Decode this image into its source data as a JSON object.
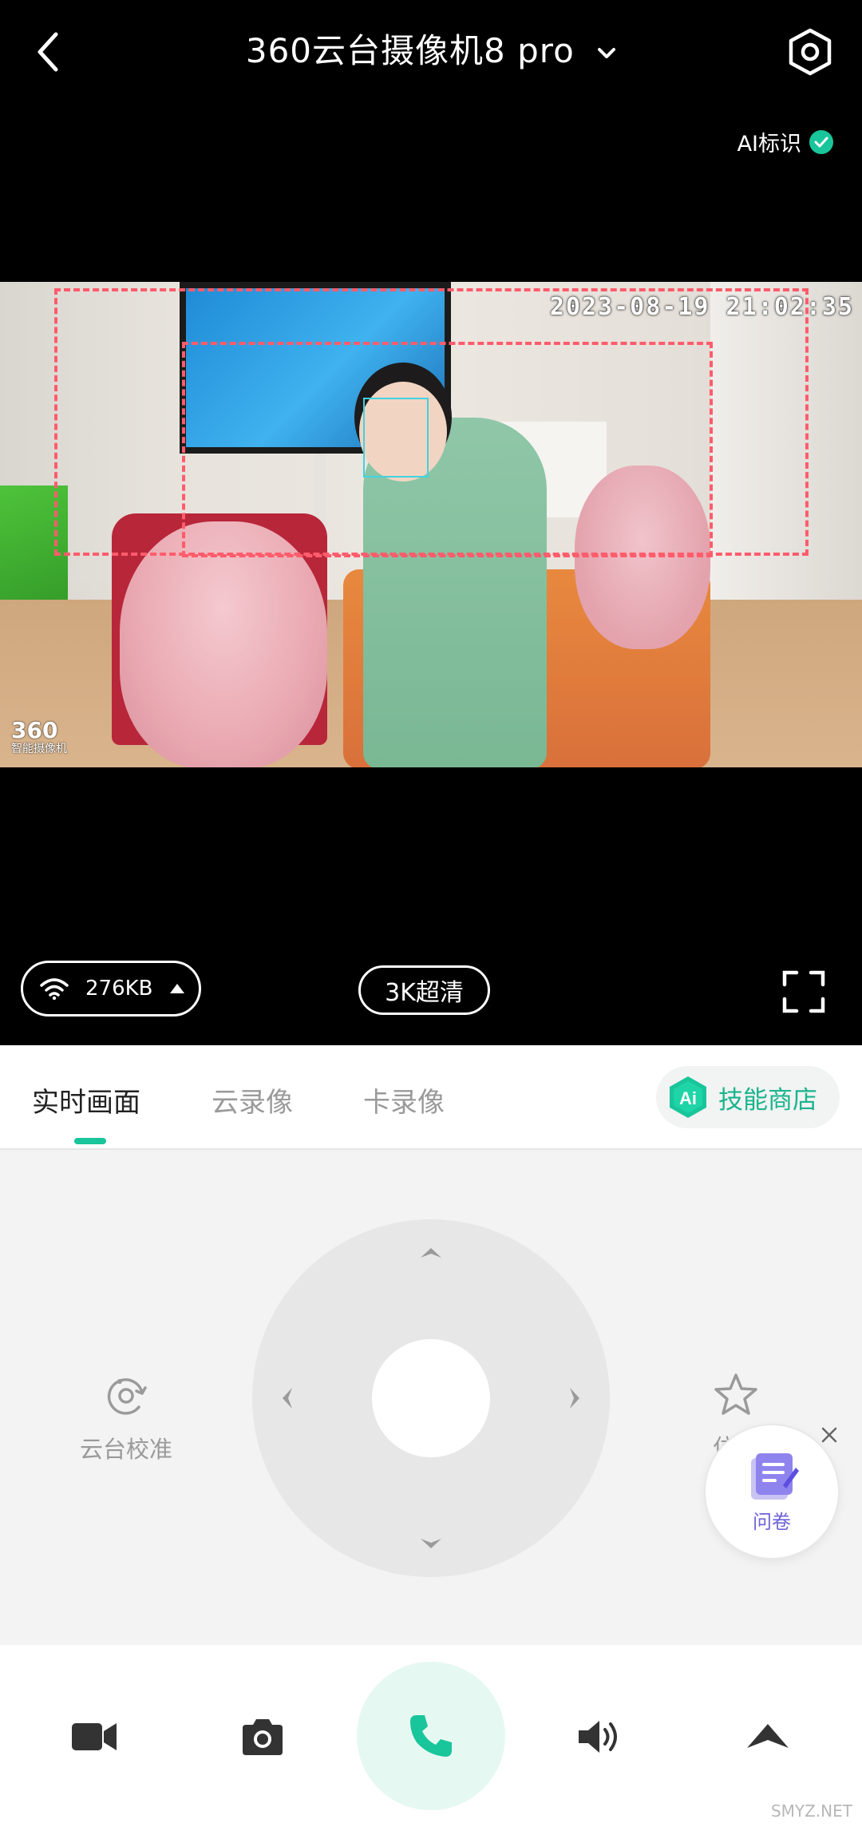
{
  "header": {
    "title": "360云台摄像机8 pro",
    "ai_tag": "AI标识"
  },
  "video": {
    "timestamp": "2023-08-19 21:02:35",
    "watermark_brand": "360",
    "watermark_sub": "智能摄像机"
  },
  "video_controls": {
    "bitrate": "276KB",
    "quality": "3K超清"
  },
  "tabs": [
    {
      "label": "实时画面",
      "active": true
    },
    {
      "label": "云录像",
      "active": false
    },
    {
      "label": "卡录像",
      "active": false
    }
  ],
  "skill_store": {
    "badge": "Ai",
    "label": "技能商店"
  },
  "ptz": {
    "calibrate_label": "云台校准",
    "position_label": "位置"
  },
  "survey": {
    "label": "问卷"
  },
  "bottom_bar": {
    "icons": [
      "video-record-icon",
      "camera-icon",
      "phone-icon",
      "speaker-icon",
      "expand-up-icon"
    ]
  },
  "site_mark": "SMYZ.NET",
  "colors": {
    "accent": "#19c59a",
    "detection": "#ff5c6c",
    "face": "#3fd3e0"
  }
}
